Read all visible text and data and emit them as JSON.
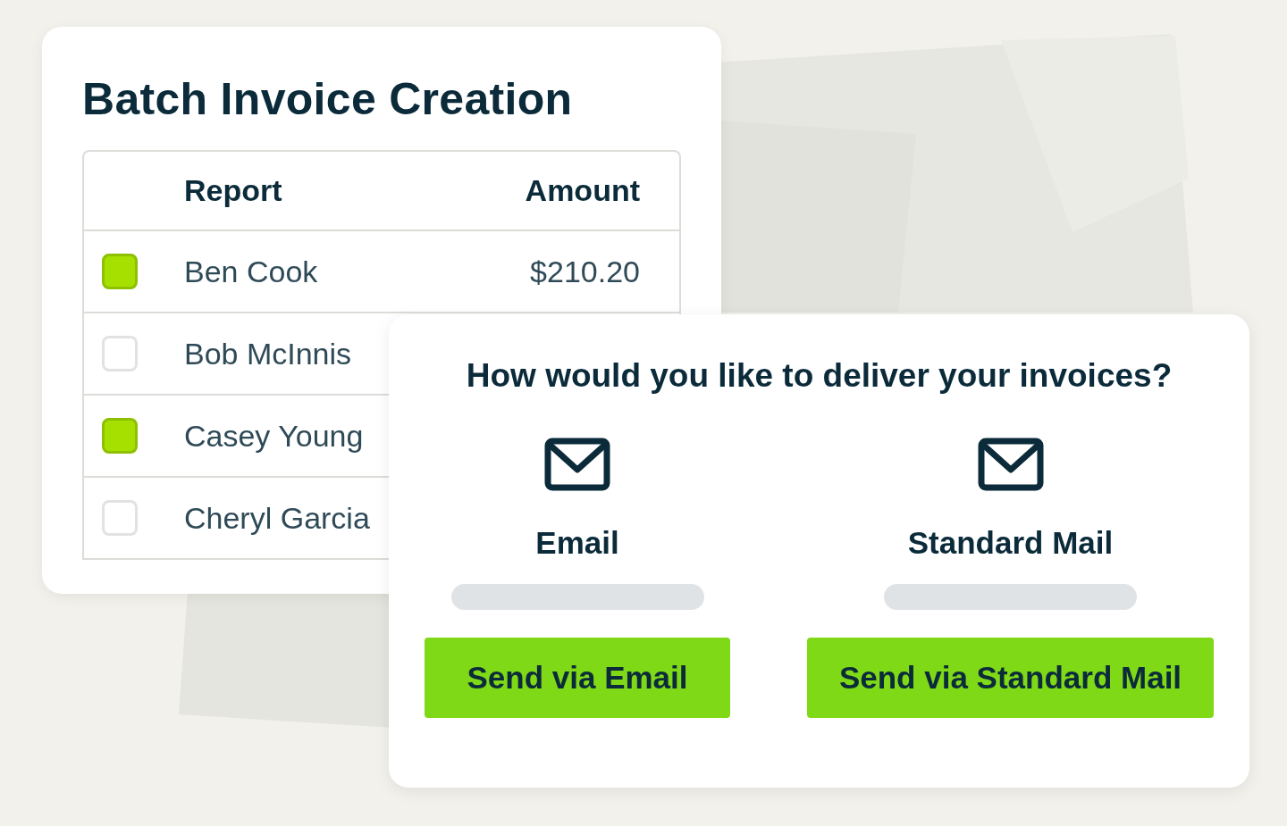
{
  "invoice_card": {
    "title": "Batch Invoice Creation",
    "table": {
      "columns": [
        "Report",
        "Amount"
      ],
      "rows": [
        {
          "name": "Ben Cook",
          "amount": "$210.20",
          "checked": true
        },
        {
          "name": "Bob McInnis",
          "checked": false
        },
        {
          "name": "Casey Young",
          "checked": true
        },
        {
          "name": "Cheryl Garcia",
          "checked": false
        }
      ]
    }
  },
  "delivery_card": {
    "question": "How would you like to deliver your invoices?",
    "options": [
      {
        "label": "Email",
        "button": "Send via Email"
      },
      {
        "label": "Standard Mail",
        "button": "Send via Standard Mail"
      }
    ]
  }
}
